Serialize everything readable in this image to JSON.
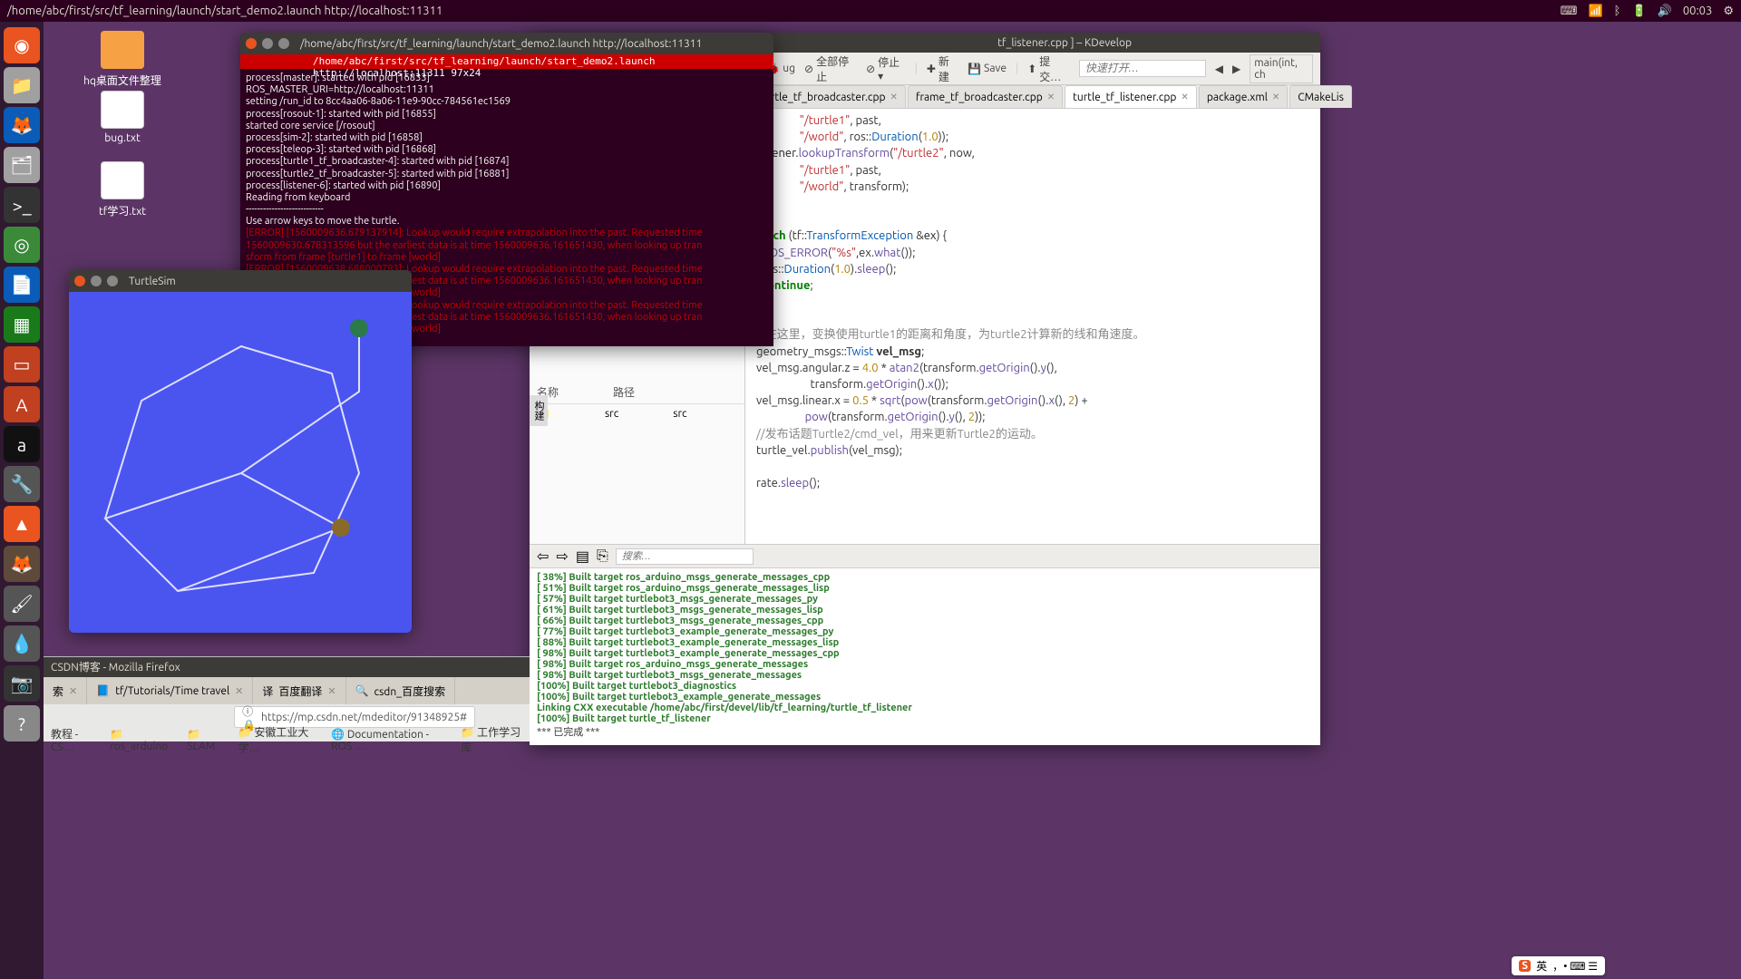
{
  "topbar": {
    "title": "/home/abc/first/src/tf_learning/launch/start_demo2.launch http://localhost:11311",
    "time": "00:03"
  },
  "desktop": {
    "folder": "hq桌面文件整理",
    "bug": "bug.txt",
    "tf": "tf学习.txt"
  },
  "terminal": {
    "title": "/home/abc/first/src/tf_learning/launch/start_demo2.launch http://localhost:11311",
    "redbar": "/home/abc/first/src/tf_learning/launch/start_demo2.launch http://localhost:11311 97x24",
    "lines_white": [
      "process[master]: started with pid [16833]",
      "ROS_MASTER_URI=http://localhost:11311",
      "",
      "setting /run_id to 8cc4aa06-8a06-11e9-90cc-784561ec1569",
      "process[rosout-1]: started with pid [16855]",
      "started core service [/rosout]",
      "process[sim-2]: started with pid [16858]",
      "process[teleop-3]: started with pid [16868]",
      "process[turtle1_tf_broadcaster-4]: started with pid [16874]",
      "process[turtle2_tf_broadcaster-5]: started with pid [16881]",
      "process[listener-6]: started with pid [16890]",
      "Reading from keyboard",
      "---------------------------",
      "Use arrow keys to move the turtle."
    ],
    "lines_err": [
      "[ERROR] [1560009636.679137914]: Lookup would require extrapolation into the past.  Requested time",
      " 1560009630.678313596 but the earliest data is at time 1560009636.161651430, when looking up tran",
      "sform from frame [turtle1] to frame [world]",
      "[ERROR] [1560009638.688000783]: Lookup would require extrapolation into the past.  Requested time",
      " 1560009632.679304126 but the earliest data is at time 1560009636.161651430, when looking up tran",
      "sform from frame [turtle1] to frame [world]",
      "[ERROR] [1560009640.690475091]: Lookup would require extrapolation into the past.  Requested time",
      " 1560009634.688974675 but the earliest data is at time 1560009636.161651430, when looking up tran",
      "sform from frame [turtle1] to frame [world]"
    ]
  },
  "turtlesim": {
    "title": "TurtleSim"
  },
  "firefox": {
    "title": "CSDN博客 - Mozilla Firefox",
    "tabs": [
      "索",
      "tf/Tutorials/Time travel",
      "百度翻译",
      "csdn_百度搜索"
    ],
    "url": "https://mp.csdn.net/mdeditor/91348925#",
    "bookmarks": [
      "教程 - CS…",
      "ros_arduino",
      "SLAM",
      "安徽工业大学…",
      "Documentation - ROS …",
      "工作学习库"
    ]
  },
  "kdev": {
    "title": "tf_listener.cpp ] – KDevelop",
    "toolbar": {
      "debug": "ug",
      "stopall": "全部停止",
      "stop": "停止 ▾",
      "new": "新建",
      "save": "Save",
      "commit": "提交…",
      "quickopen_ph": "快速打开…",
      "outline": "main(int, ch"
    },
    "tabs": [
      {
        "label": "urtle_tf_broadcaster.cpp",
        "active": false
      },
      {
        "label": "frame_tf_broadcaster.cpp",
        "active": false
      },
      {
        "label": "turtle_tf_listener.cpp",
        "active": true
      },
      {
        "label": "package.xml",
        "active": false
      },
      {
        "label": "CMakeLis",
        "active": false
      }
    ],
    "left_hdr_name": "名称",
    "left_hdr_path": "路径",
    "left_row_name": "src",
    "left_row_path": "src",
    "search_ph": "搜索…",
    "output": [
      "[ 38%] Built target ros_arduino_msgs_generate_messages_cpp",
      "[ 51%] Built target ros_arduino_msgs_generate_messages_lisp",
      "[ 57%] Built target turtlebot3_msgs_generate_messages_py",
      "[ 61%] Built target turtlebot3_msgs_generate_messages_lisp",
      "[ 66%] Built target turtlebot3_msgs_generate_messages_cpp",
      "[ 77%] Built target turtlebot3_example_generate_messages_py",
      "[ 88%] Built target turtlebot3_example_generate_messages_lisp",
      "[ 98%] Built target turtlebot3_example_generate_messages_cpp",
      "[ 98%] Built target ros_arduino_msgs_generate_messages",
      "[ 98%] Built target turtlebot3_msgs_generate_messages",
      "[100%] Built target turtlebot3_diagnostics",
      "[100%] Built target turtlebot3_example_generate_messages",
      "Linking CXX executable /home/abc/first/devel/lib/tf_learning/turtle_tf_listener",
      "[100%] Built target turtle_tf_listener"
    ],
    "done": "*** 已完成 ***",
    "sidehandle": "构建"
  },
  "ime": {
    "s": "S",
    "lang": "英"
  }
}
